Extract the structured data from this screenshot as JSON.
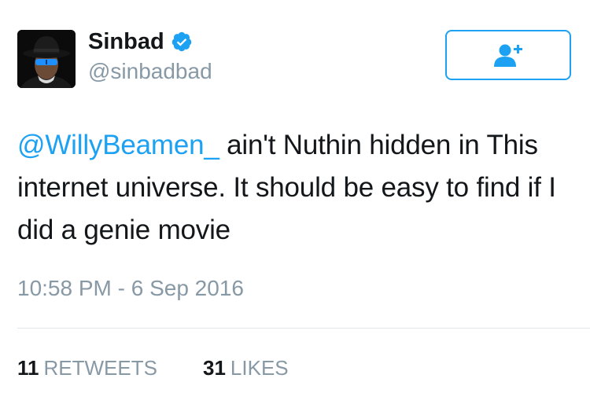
{
  "tweet": {
    "author": {
      "display_name": "Sinbad",
      "handle": "@sinbadbad",
      "verified": true,
      "avatar_icon": "profile-photo-hat-sunglasses"
    },
    "follow_button": {
      "icon": "follow-user-plus-icon",
      "color": "#1da1f2"
    },
    "text": {
      "mention": "@WillyBeamen_",
      "body": " ain't Nuthin hidden in This internet universe. It should be easy to find if I did a genie movie"
    },
    "timestamp": "10:58 PM - 6 Sep 2016",
    "stats": {
      "retweets": {
        "count": "11",
        "label": "RETWEETS"
      },
      "likes": {
        "count": "31",
        "label": "LIKES"
      }
    }
  },
  "colors": {
    "accent": "#1da1f2",
    "text": "#14171a",
    "secondary": "#8899a6",
    "divider": "#e1e8ed"
  }
}
